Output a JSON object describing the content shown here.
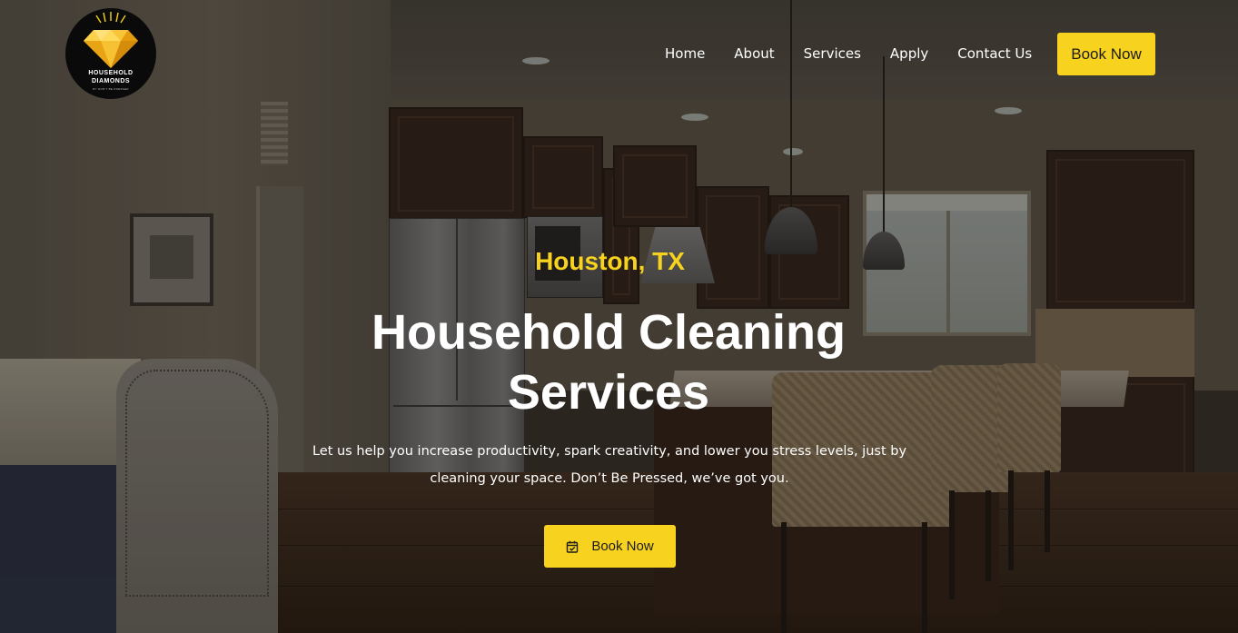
{
  "brand": {
    "name_line1": "HOUSEHOLD",
    "name_line2": "DIAMONDS",
    "tagline": "BY DON'T BE PRESSED",
    "accent_color": "#f7d21e",
    "logo_icon": "diamond-icon"
  },
  "nav": {
    "items": [
      {
        "label": "Home"
      },
      {
        "label": "About"
      },
      {
        "label": "Services"
      },
      {
        "label": "Apply"
      },
      {
        "label": "Contact Us"
      }
    ],
    "cta_label": "Book Now"
  },
  "hero": {
    "location": "Houston, TX",
    "headline": "Household Cleaning Services",
    "subtext": "Let us help you increase productivity, spark creativity, and lower you stress levels, just by cleaning your space. Don’t Be Pressed, we’ve got you.",
    "cta_label": "Book Now",
    "cta_icon": "calendar-check-icon",
    "background": "kitchen-photo"
  }
}
